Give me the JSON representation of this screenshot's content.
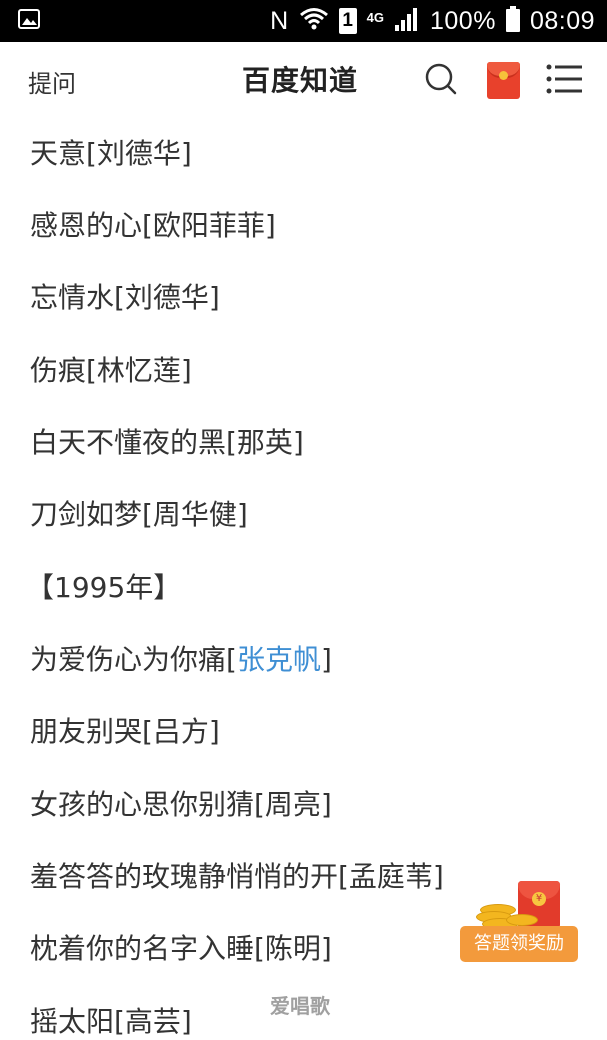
{
  "status_bar": {
    "n_icon": "N",
    "sim_slot": "1",
    "network_type": "4G",
    "battery": "100%",
    "time": "08:09",
    "icons": [
      "image-notification-icon",
      "nfc-icon",
      "wifi-icon",
      "signal-icon",
      "battery-icon"
    ]
  },
  "header": {
    "ask_label": "提问",
    "title": "百度知道",
    "icons": [
      "search-icon",
      "red-packet-icon",
      "menu-icon"
    ]
  },
  "song_list": [
    {
      "song": "天意",
      "artist": "刘德华",
      "text": "天意[刘德华]"
    },
    {
      "song": "感恩的心",
      "artist": "欧阳菲菲",
      "text": "感恩的心[欧阳菲菲]"
    },
    {
      "song": "忘情水",
      "artist": "刘德华",
      "text": "忘情水[刘德华]"
    },
    {
      "song": "伤痕",
      "artist": "林忆莲",
      "text": "伤痕[林忆莲]"
    },
    {
      "song": "白天不懂夜的黑",
      "artist": "那英",
      "text": "白天不懂夜的黑[那英]"
    },
    {
      "song": "刀剑如梦",
      "artist": "周华健",
      "text": "刀剑如梦[周华健]"
    },
    {
      "text": "【1995年】"
    },
    {
      "song": "为爱伤心为你痛",
      "artist": "张克帆",
      "prefix": "为爱伤心为你痛[",
      "link": "张克帆",
      "suffix": "]"
    },
    {
      "song": "朋友别哭",
      "artist": "吕方",
      "text": "朋友别哭[吕方]"
    },
    {
      "song": "女孩的心思你别猜",
      "artist": "周亮",
      "text": "女孩的心思你别猜[周亮]"
    },
    {
      "song": "羞答答的玫瑰静悄悄的开",
      "artist": "孟庭苇",
      "text": "羞答答的玫瑰静悄悄的开[孟庭苇]"
    },
    {
      "song": "枕着你的名字入睡",
      "artist": "陈明",
      "text": "枕着你的名字入睡[陈明]"
    },
    {
      "text": "摇太阳[高芸]"
    }
  ],
  "reward_button": {
    "label": "答题领奖励",
    "seal": "¥"
  },
  "watermark": "爱唱歌",
  "colors": {
    "link": "#3f8fd4",
    "red_packet": "#e8412c",
    "reward_pill": "#f39a3c",
    "text": "#333333"
  }
}
